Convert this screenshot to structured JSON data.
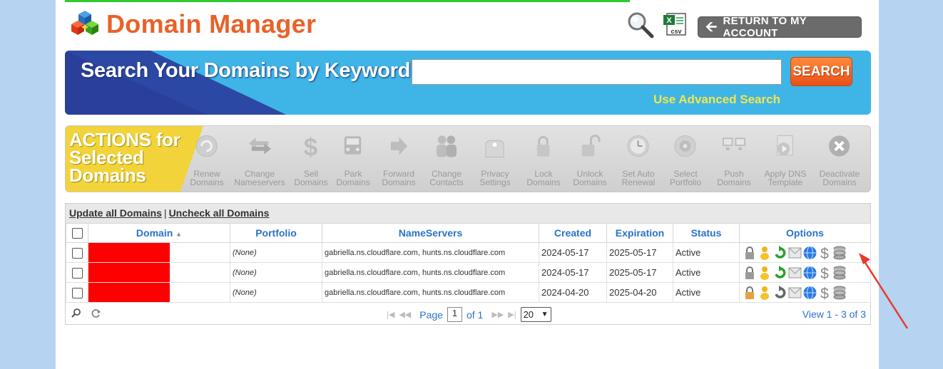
{
  "header": {
    "title": "Domain Manager",
    "csv_label": "csv",
    "return_label": "RETURN TO MY ACCOUNT"
  },
  "search": {
    "label": "Search Your Domains by Keyword",
    "value": "",
    "placeholder": "",
    "button": "SEARCH",
    "advanced": "Use Advanced Search"
  },
  "actions": {
    "label_line1": "ACTIONS for",
    "label_line2": "Selected",
    "label_line3": "Domains",
    "items": [
      {
        "l1": "Renew",
        "l2": "Domains",
        "icon": "refresh-icon"
      },
      {
        "l1": "Change",
        "l2": "Nameservers",
        "icon": "swap-arrows-icon"
      },
      {
        "l1": "Sell",
        "l2": "Domains",
        "icon": "dollar-icon"
      },
      {
        "l1": "Park",
        "l2": "Domains",
        "icon": "car-icon"
      },
      {
        "l1": "Forward",
        "l2": "Domains",
        "icon": "forward-arrow-icon"
      },
      {
        "l1": "Change",
        "l2": "Contacts",
        "icon": "people-icon"
      },
      {
        "l1": "Privacy",
        "l2": "Settings",
        "icon": "privacy-tag-icon"
      },
      {
        "l1": "Lock",
        "l2": "Domains",
        "icon": "lock-icon"
      },
      {
        "l1": "Unlock",
        "l2": "Domains",
        "icon": "unlock-icon"
      },
      {
        "l1": "Set Auto",
        "l2": "Renewal",
        "icon": "clock-icon"
      },
      {
        "l1": "Select",
        "l2": "Portfolio",
        "icon": "portfolio-icon"
      },
      {
        "l1": "Push",
        "l2": "Domains",
        "icon": "push-monitors-icon"
      },
      {
        "l1": "Apply DNS",
        "l2": "Template",
        "icon": "dns-template-icon"
      },
      {
        "l1": "Deactivate",
        "l2": "Domains",
        "icon": "close-circle-icon"
      }
    ]
  },
  "grid": {
    "update_all": "Update all Domains",
    "separator": "|",
    "uncheck_all": "Uncheck all Domains",
    "columns": [
      "Domain",
      "Portfolio",
      "NameServers",
      "Created",
      "Expiration",
      "Status",
      "Options"
    ],
    "rows": [
      {
        "domain": "",
        "portfolio": "(None)",
        "nameservers": "gabriella.ns.cloudflare.com, hunts.ns.cloudflare.com",
        "created": "2024-05-17",
        "expiration": "2025-05-17",
        "status": "Active",
        "renew_color": "#2aa12a"
      },
      {
        "domain": "",
        "portfolio": "(None)",
        "nameservers": "gabriella.ns.cloudflare.com, hunts.ns.cloudflare.com",
        "created": "2024-05-17",
        "expiration": "2025-05-17",
        "status": "Active",
        "renew_color": "#2aa12a"
      },
      {
        "domain": "",
        "portfolio": "(None)",
        "nameservers": "gabriella.ns.cloudflare.com, hunts.ns.cloudflare.com",
        "created": "2024-04-20",
        "expiration": "2025-04-20",
        "status": "Active",
        "renew_color": "#666666"
      }
    ],
    "pager": {
      "page_label": "Page",
      "page_value": "1",
      "of_label": "of 1",
      "page_size": "20",
      "view_info": "View 1 - 3 of 3"
    }
  },
  "colors": {
    "title": "#e8622a",
    "accent_blue": "#2a72c8",
    "search_button": "#f06a2a",
    "advanced_link": "#f5e64a",
    "redaction": "#ff0000",
    "annotation_arrow": "#e83a2a"
  }
}
